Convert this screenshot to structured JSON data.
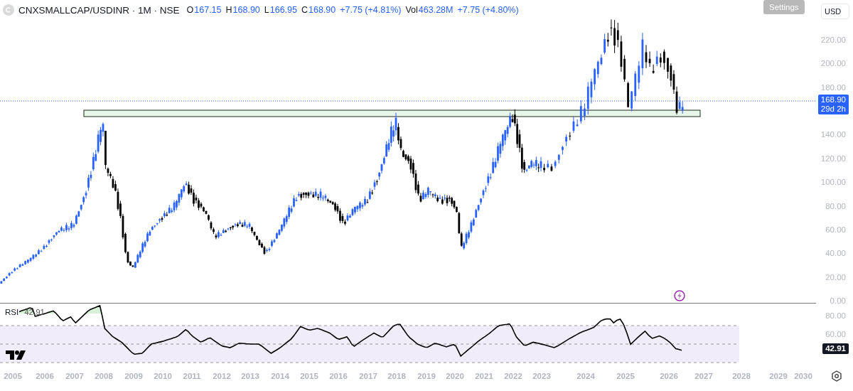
{
  "header": {
    "symbol": "CNXSMALLCAP/USDINR · 1M · NSE",
    "ohlc": [
      {
        "label": "O",
        "value": "167.15"
      },
      {
        "label": "H",
        "value": "168.90"
      },
      {
        "label": "L",
        "value": "166.95"
      },
      {
        "label": "C",
        "value": "168.90"
      }
    ],
    "change": "+7.75 (+4.81%)",
    "volume": {
      "label": "Vol",
      "value": "463.28M",
      "change": "+7.75 (+4.80%)"
    }
  },
  "settings_button": "Settings",
  "currency": "USD",
  "price_axis": [
    "220.00",
    "200.00",
    "180.00",
    "140.00",
    "120.00",
    "100.00",
    "80.00",
    "60.00",
    "40.00",
    "20.00",
    "0.00"
  ],
  "last_price": {
    "value": "168.90",
    "countdown": "29d 2h"
  },
  "rsi": {
    "label": "RSI",
    "value": "42.91",
    "axis": [
      "80.00",
      "60.00"
    ],
    "tag": "42.91"
  },
  "time_axis": [
    "2005",
    "2006",
    "2007",
    "2008",
    "2009",
    "2010",
    "2011",
    "2012",
    "2013",
    "2014",
    "2015",
    "2016",
    "2017",
    "2018",
    "2019",
    "2020",
    "2021",
    "2022",
    "2023",
    "2024",
    "2025",
    "2026",
    "2027",
    "2028",
    "2029",
    "2030"
  ]
}
